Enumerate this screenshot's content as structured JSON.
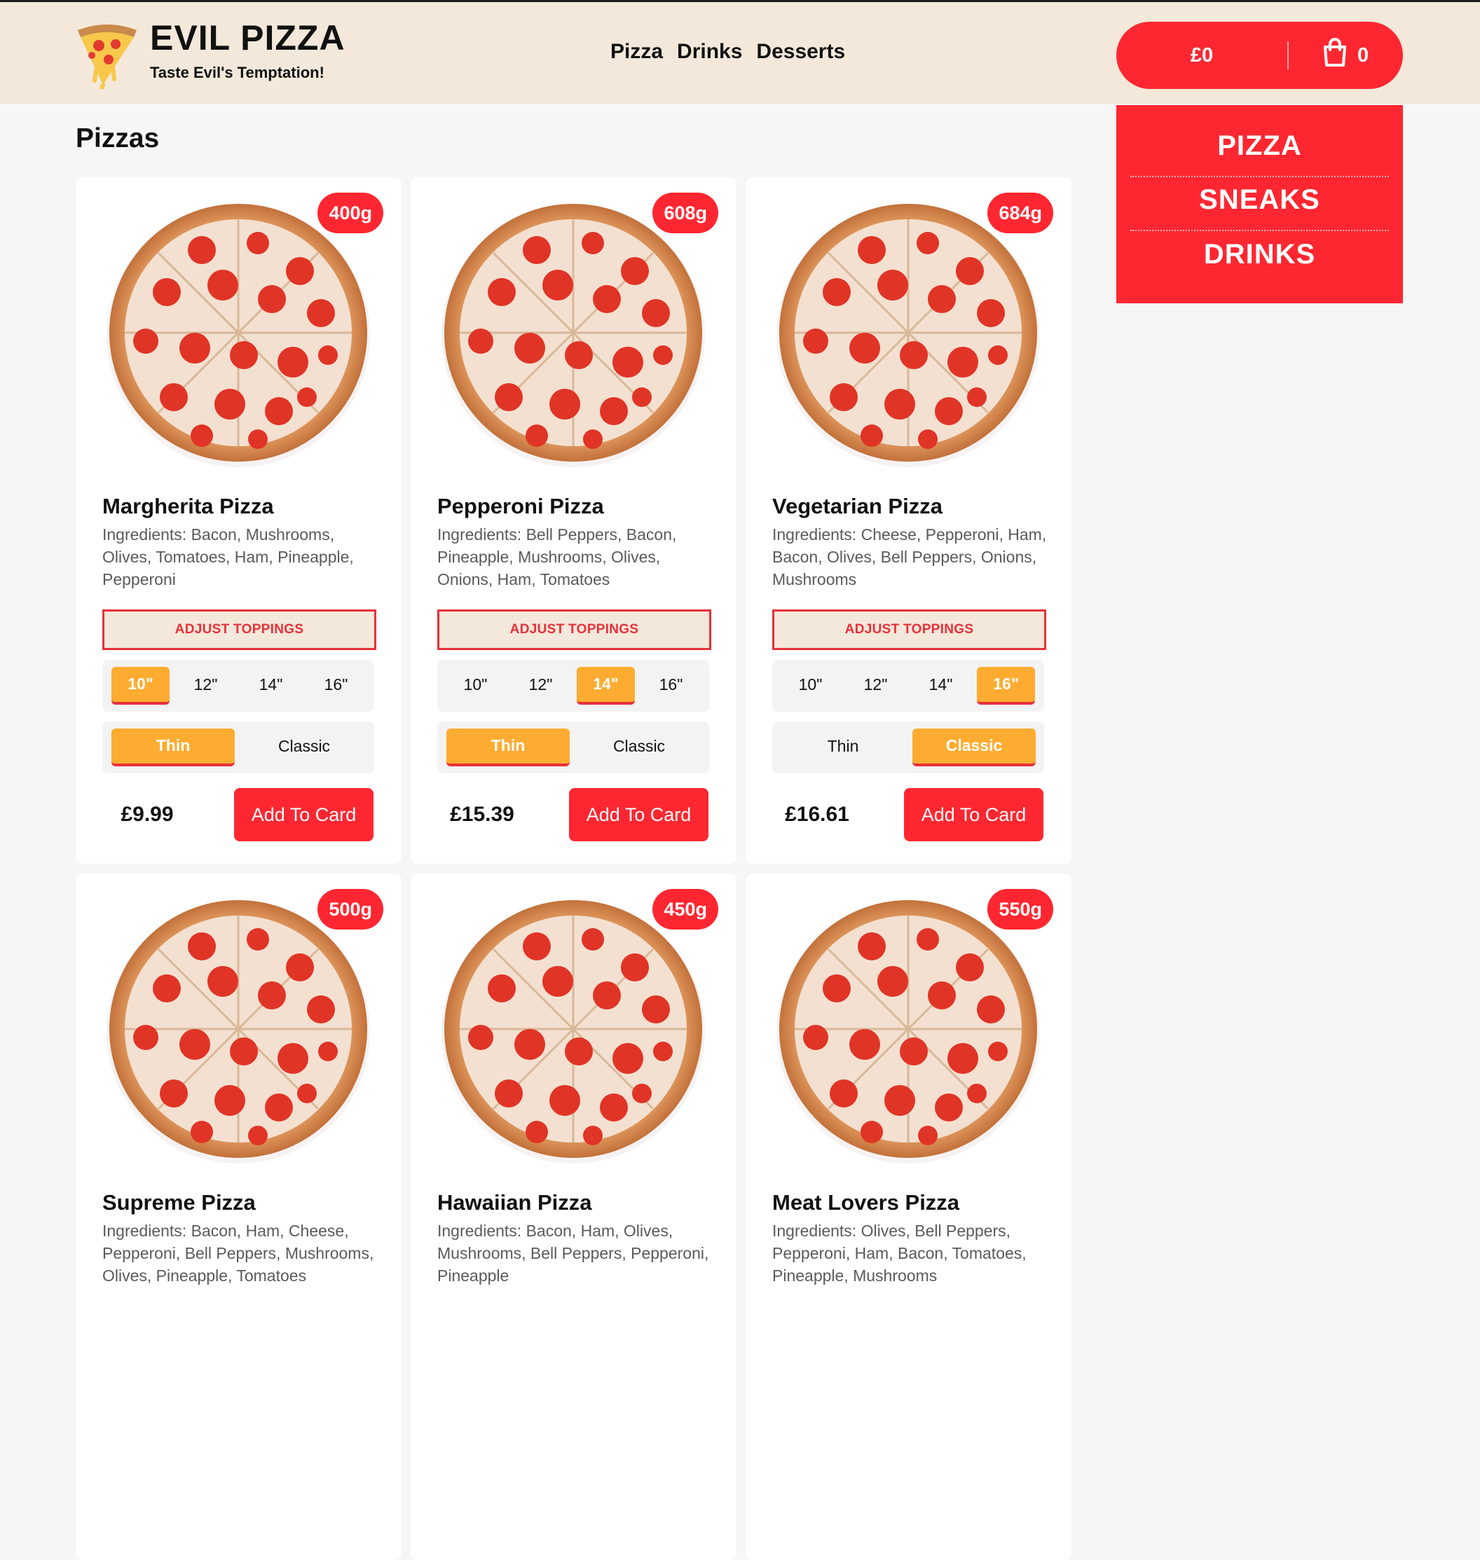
{
  "header": {
    "brand_title": "EVIL PIZZA",
    "brand_subtitle": "Taste Evil's Temptation!",
    "nav": [
      "Pizza",
      "Drinks",
      "Desserts"
    ]
  },
  "cart": {
    "total": "£0",
    "count": "0"
  },
  "dropdown": {
    "items": [
      "PIZZA",
      "SNEAKS",
      "DRINKS"
    ]
  },
  "section_title": "Pizzas",
  "common": {
    "adjust_label": "ADJUST TOPPINGS",
    "sizes": [
      "10\"",
      "12\"",
      "14\"",
      "16\""
    ],
    "crusts": [
      "Thin",
      "Classic"
    ],
    "add_label": "Add To Card"
  },
  "colors": {
    "accent_red": "#fe2731",
    "selected_orange": "#fdac31",
    "header_bg": "#f3e8da"
  },
  "pizzas": [
    {
      "name": "Margherita Pizza",
      "weight": "400g",
      "ingredients": "Ingredients: Bacon, Mushrooms, Olives, Tomatoes, Ham, Pineapple, Pepperoni",
      "price": "£9.99",
      "selected_size": 0,
      "selected_crust": 0
    },
    {
      "name": "Pepperoni Pizza",
      "weight": "608g",
      "ingredients": "Ingredients: Bell Peppers, Bacon, Pineapple, Mushrooms, Olives, Onions, Ham, Tomatoes",
      "price": "£15.39",
      "selected_size": 2,
      "selected_crust": 0
    },
    {
      "name": "Vegetarian Pizza",
      "weight": "684g",
      "ingredients": "Ingredients: Cheese, Pepperoni, Ham, Bacon, Olives, Bell Peppers, Onions, Mushrooms",
      "price": "£16.61",
      "selected_size": 3,
      "selected_crust": 1
    },
    {
      "name": "Supreme Pizza",
      "weight": "500g",
      "ingredients": "Ingredients: Bacon, Ham, Cheese, Pepperoni, Bell Peppers, Mushrooms, Olives, Pineapple, Tomatoes"
    },
    {
      "name": "Hawaiian Pizza",
      "weight": "450g",
      "ingredients": "Ingredients: Bacon, Ham, Olives, Mushrooms, Bell Peppers, Pepperoni, Pineapple"
    },
    {
      "name": "Meat Lovers Pizza",
      "weight": "550g",
      "ingredients": "Ingredients: Olives, Bell Peppers, Pepperoni, Ham, Bacon, Tomatoes, Pineapple, Mushrooms"
    }
  ]
}
